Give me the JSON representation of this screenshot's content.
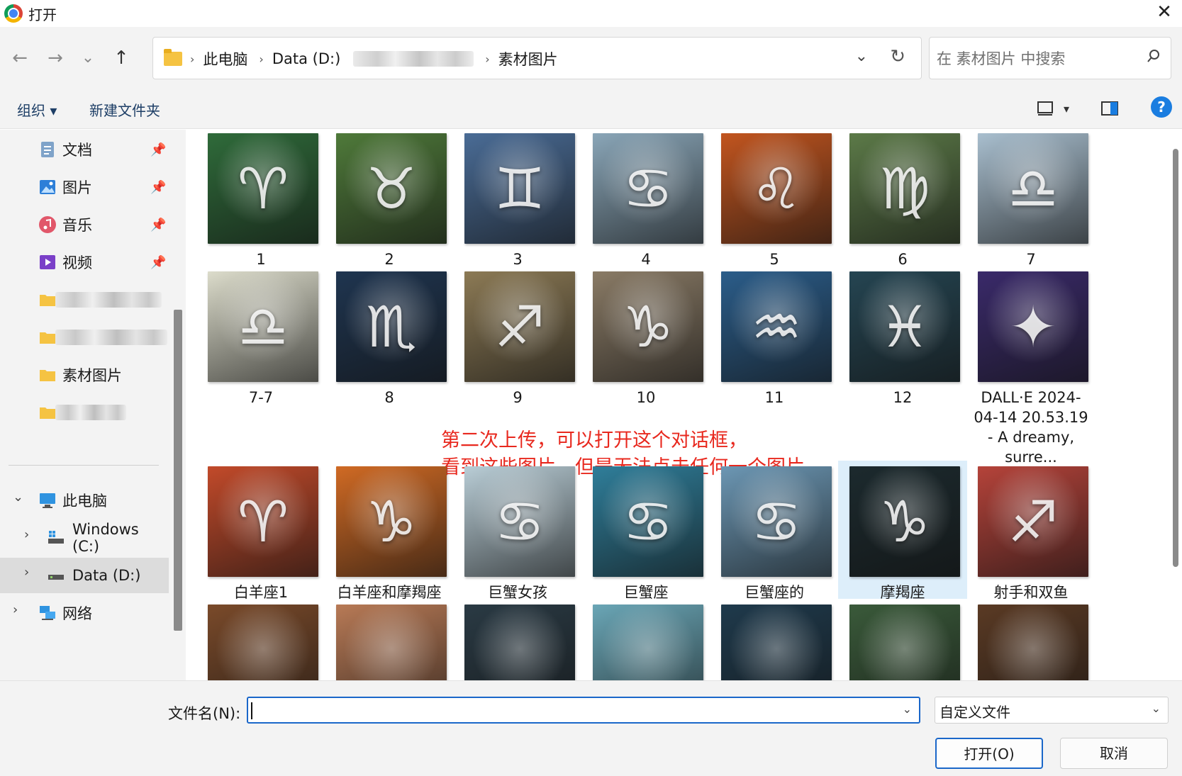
{
  "window": {
    "title": "打开",
    "close": "✕"
  },
  "nav": {
    "back": "←",
    "forward": "→",
    "recent": "⌄",
    "up": "↑",
    "breadcrumbs": [
      "此电脑",
      "Data (D:)",
      "素材图片"
    ],
    "dropdown": "⌄",
    "refresh": "↻"
  },
  "search": {
    "placeholder": "在 素材图片 中搜索"
  },
  "toolbar": {
    "organize": "组织 ▾",
    "new_folder": "新建文件夹",
    "view_dropdown": "▾",
    "help": "?"
  },
  "sidebar": {
    "quick": [
      {
        "label": "文档"
      },
      {
        "label": "图片"
      },
      {
        "label": "音乐"
      },
      {
        "label": "视频"
      }
    ],
    "folder_current": "素材图片",
    "this_pc": "此电脑",
    "drive_c": "Windows (C:)",
    "drive_d": "Data (D:)",
    "network": "网络",
    "pin": "📌",
    "chevron_open": "⌄",
    "chevron_closed": "›"
  },
  "files": [
    {
      "name": "1",
      "sym": "♈",
      "bg": "#2f6b3a"
    },
    {
      "name": "2",
      "sym": "♉",
      "bg": "#4f7a3a"
    },
    {
      "name": "3",
      "sym": "♊",
      "bg": "#4a6c96"
    },
    {
      "name": "4",
      "sym": "♋",
      "bg": "#8aa6b8"
    },
    {
      "name": "5",
      "sym": "♌",
      "bg": "#c2551f"
    },
    {
      "name": "6",
      "sym": "♍",
      "bg": "#5c7a48"
    },
    {
      "name": "7",
      "sym": "♎",
      "bg": "#a9bfcf"
    },
    {
      "name": "7-7",
      "sym": "♎",
      "bg": "#dcdccb"
    },
    {
      "name": "8",
      "sym": "♏",
      "bg": "#1f3550"
    },
    {
      "name": "9",
      "sym": "♐",
      "bg": "#8c7a55"
    },
    {
      "name": "10",
      "sym": "♑",
      "bg": "#8a7b66"
    },
    {
      "name": "11",
      "sym": "♒",
      "bg": "#2b5d8a"
    },
    {
      "name": "12",
      "sym": "♓",
      "bg": "#254552"
    },
    {
      "name": "DALL·E 2024-04-14 20.53.19 - A dreamy, surre...",
      "sym": "✦",
      "bg": "#3a2a6a"
    },
    {
      "name": "白羊座1",
      "sym": "♈",
      "bg": "#c24a2a"
    },
    {
      "name": "白羊座和摩羯座",
      "sym": "♑",
      "bg": "#d06a24"
    },
    {
      "name": "巨蟹女孩",
      "sym": "♋",
      "bg": "#b9cdd6"
    },
    {
      "name": "巨蟹座",
      "sym": "♋",
      "bg": "#2f7e9a"
    },
    {
      "name": "巨蟹座的",
      "sym": "♋",
      "bg": "#6c97b4"
    },
    {
      "name": "摩羯座",
      "sym": "♑",
      "bg": "#1c2a2e"
    },
    {
      "name": "射手和双鱼",
      "sym": "♐",
      "bg": "#b5433a"
    },
    {
      "name": "",
      "sym": "",
      "bg": "#7a4a2a"
    },
    {
      "name": "",
      "sym": "",
      "bg": "#b87a56"
    },
    {
      "name": "",
      "sym": "",
      "bg": "#2a3a44"
    },
    {
      "name": "",
      "sym": "",
      "bg": "#6aa6b6"
    },
    {
      "name": "",
      "sym": "",
      "bg": "#1f3a4c"
    },
    {
      "name": "",
      "sym": "",
      "bg": "#3a5a3a"
    },
    {
      "name": "",
      "sym": "",
      "bg": "#5a3a24"
    }
  ],
  "annotation": {
    "line1": "第二次上传，可以打开这个对话框，",
    "line2": "看到这些图片，但是无法点击任何一个图片"
  },
  "bottom": {
    "filename_label": "文件名(N):",
    "filename_value": "",
    "filetype": "自定义文件",
    "open_button": "打开(O)",
    "cancel_button": "取消",
    "dropdown": "⌄"
  }
}
